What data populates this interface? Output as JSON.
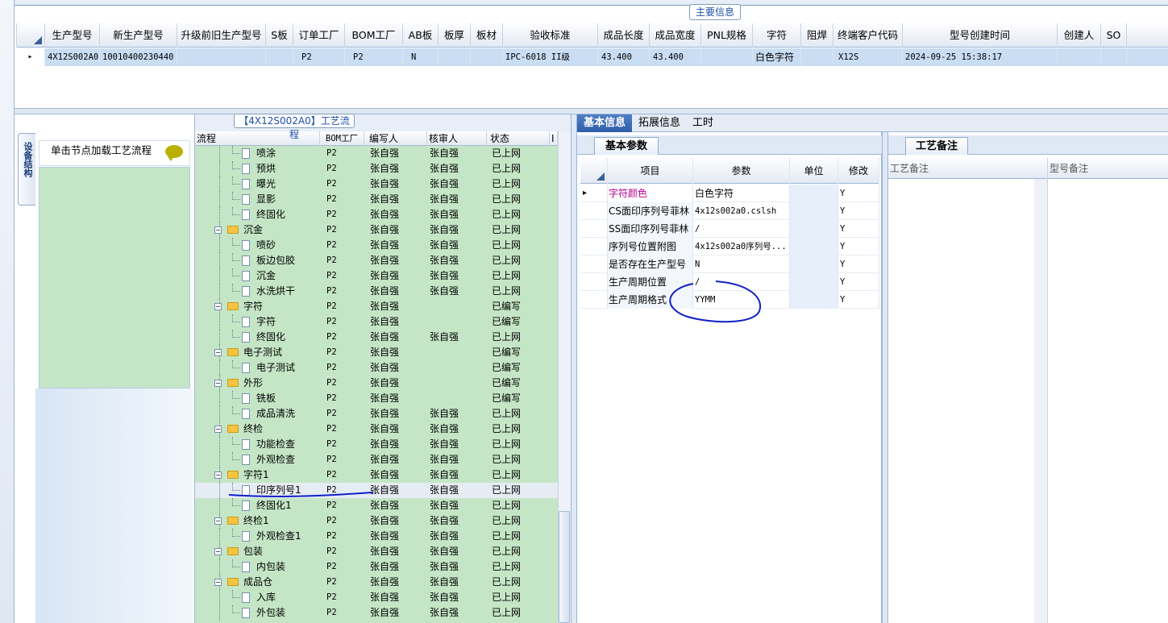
{
  "main_info": {
    "title": "主要信息",
    "columns": [
      "生产型号",
      "新生产型号",
      "升级前旧生产型号",
      "S板",
      "订单工厂",
      "BOM工厂",
      "AB板",
      "板厚",
      "板材",
      "验收标准",
      "成品长度",
      "成品宽度",
      "PNL规格",
      "字符",
      "阻焊",
      "终端客户代码",
      "型号创建时间",
      "创建人",
      "SO"
    ],
    "row": {
      "生产型号": "4X12S002A0",
      "新生产型号": "10010400230440",
      "订单工厂": "P2",
      "BOM工厂": "P2",
      "AB板": "N",
      "验收标准": "IPC-6018 II级",
      "成品长度": "43.400",
      "成品宽度": "43.400",
      "字符": "白色字符",
      "终端客户代码": "X12S",
      "型号创建时间": "2024-09-25 15:38:17"
    }
  },
  "left_panel": {
    "side_tab": "设备结构",
    "hint": "单击节点加载工艺流程"
  },
  "process": {
    "title": "【4X12S002A0】工艺流程",
    "headers": [
      "流程",
      "BOM工厂",
      "编写人",
      "核审人",
      "状态",
      "I"
    ],
    "rows": [
      {
        "level": 2,
        "type": "doc",
        "name": "喷涂",
        "bom": "P2",
        "writer": "张自强",
        "reviewer": "张自强",
        "status": "已上网"
      },
      {
        "level": 2,
        "type": "doc",
        "name": "预烘",
        "bom": "P2",
        "writer": "张自强",
        "reviewer": "张自强",
        "status": "已上网"
      },
      {
        "level": 2,
        "type": "doc",
        "name": "曝光",
        "bom": "P2",
        "writer": "张自强",
        "reviewer": "张自强",
        "status": "已上网"
      },
      {
        "level": 2,
        "type": "doc",
        "name": "显影",
        "bom": "P2",
        "writer": "张自强",
        "reviewer": "张自强",
        "status": "已上网"
      },
      {
        "level": 2,
        "type": "doc",
        "name": "终固化",
        "bom": "P2",
        "writer": "张自强",
        "reviewer": "张自强",
        "status": "已上网"
      },
      {
        "level": 1,
        "type": "folder",
        "name": "沉金",
        "bom": "P2",
        "writer": "张自强",
        "reviewer": "张自强",
        "status": "已上网"
      },
      {
        "level": 2,
        "type": "doc",
        "name": "喷砂",
        "bom": "P2",
        "writer": "张自强",
        "reviewer": "张自强",
        "status": "已上网"
      },
      {
        "level": 2,
        "type": "doc",
        "name": "板边包胶",
        "bom": "P2",
        "writer": "张自强",
        "reviewer": "张自强",
        "status": "已上网"
      },
      {
        "level": 2,
        "type": "doc",
        "name": "沉金",
        "bom": "P2",
        "writer": "张自强",
        "reviewer": "张自强",
        "status": "已上网"
      },
      {
        "level": 2,
        "type": "doc",
        "name": "水洗烘干",
        "bom": "P2",
        "writer": "张自强",
        "reviewer": "张自强",
        "status": "已上网"
      },
      {
        "level": 1,
        "type": "folder",
        "name": "字符",
        "bom": "P2",
        "writer": "张自强",
        "reviewer": "",
        "status": "已编写"
      },
      {
        "level": 2,
        "type": "doc",
        "name": "字符",
        "bom": "P2",
        "writer": "张自强",
        "reviewer": "",
        "status": "已编写"
      },
      {
        "level": 2,
        "type": "doc",
        "name": "终固化",
        "bom": "P2",
        "writer": "张自强",
        "reviewer": "张自强",
        "status": "已上网"
      },
      {
        "level": 1,
        "type": "folder",
        "name": "电子测试",
        "bom": "P2",
        "writer": "张自强",
        "reviewer": "",
        "status": "已编写"
      },
      {
        "level": 2,
        "type": "doc",
        "name": "电子测试",
        "bom": "P2",
        "writer": "张自强",
        "reviewer": "",
        "status": "已编写"
      },
      {
        "level": 1,
        "type": "folder",
        "name": "外形",
        "bom": "P2",
        "writer": "张自强",
        "reviewer": "",
        "status": "已编写"
      },
      {
        "level": 2,
        "type": "doc",
        "name": "铣板",
        "bom": "P2",
        "writer": "张自强",
        "reviewer": "",
        "status": "已编写"
      },
      {
        "level": 2,
        "type": "doc",
        "name": "成品清洗",
        "bom": "P2",
        "writer": "张自强",
        "reviewer": "张自强",
        "status": "已上网"
      },
      {
        "level": 1,
        "type": "folder",
        "name": "终检",
        "bom": "P2",
        "writer": "张自强",
        "reviewer": "张自强",
        "status": "已上网"
      },
      {
        "level": 2,
        "type": "doc",
        "name": "功能检查",
        "bom": "P2",
        "writer": "张自强",
        "reviewer": "张自强",
        "status": "已上网"
      },
      {
        "level": 2,
        "type": "doc",
        "name": "外观检查",
        "bom": "P2",
        "writer": "张自强",
        "reviewer": "张自强",
        "status": "已上网"
      },
      {
        "level": 1,
        "type": "folder",
        "name": "字符1",
        "bom": "P2",
        "writer": "张自强",
        "reviewer": "张自强",
        "status": "已上网"
      },
      {
        "level": 2,
        "type": "doc",
        "name": "印序列号1",
        "bom": "P2",
        "writer": "张自强",
        "reviewer": "张自强",
        "status": "已上网",
        "selected": true
      },
      {
        "level": 2,
        "type": "doc",
        "name": "终固化1",
        "bom": "P2",
        "writer": "张自强",
        "reviewer": "张自强",
        "status": "已上网"
      },
      {
        "level": 1,
        "type": "folder",
        "name": "终检1",
        "bom": "P2",
        "writer": "张自强",
        "reviewer": "张自强",
        "status": "已上网"
      },
      {
        "level": 2,
        "type": "doc",
        "name": "外观检查1",
        "bom": "P2",
        "writer": "张自强",
        "reviewer": "张自强",
        "status": "已上网"
      },
      {
        "level": 1,
        "type": "folder",
        "name": "包装",
        "bom": "P2",
        "writer": "张自强",
        "reviewer": "张自强",
        "status": "已上网"
      },
      {
        "level": 2,
        "type": "doc",
        "name": "内包装",
        "bom": "P2",
        "writer": "张自强",
        "reviewer": "张自强",
        "status": "已上网"
      },
      {
        "level": 1,
        "type": "folder",
        "name": "成品仓",
        "bom": "P2",
        "writer": "张自强",
        "reviewer": "张自强",
        "status": "已上网"
      },
      {
        "level": 2,
        "type": "doc",
        "name": "入库",
        "bom": "P2",
        "writer": "张自强",
        "reviewer": "张自强",
        "status": "已上网"
      },
      {
        "level": 2,
        "type": "doc",
        "name": "外包装",
        "bom": "P2",
        "writer": "张自强",
        "reviewer": "张自强",
        "status": "已上网"
      }
    ]
  },
  "right_tabs": [
    "基本信息",
    "拓展信息",
    "工时"
  ],
  "basic": {
    "tab": "基本参数",
    "headers": [
      "项目",
      "参数",
      "单位",
      "修改"
    ],
    "rows": [
      {
        "item": "字符颜色",
        "param": "白色字符",
        "unit": "",
        "modify": "Y",
        "highlight": true
      },
      {
        "item": "CS面印序列号菲林",
        "param": "4x12s002a0.cslsh",
        "unit": "",
        "modify": "Y"
      },
      {
        "item": "SS面印序列号菲林",
        "param": "/",
        "unit": "",
        "modify": "Y"
      },
      {
        "item": "序列号位置附图",
        "param": "4x12s002a0序列号...",
        "unit": "",
        "modify": "Y"
      },
      {
        "item": "是否存在生产型号",
        "param": "N",
        "unit": "",
        "modify": "Y"
      },
      {
        "item": "生产周期位置",
        "param": "/",
        "unit": "",
        "modify": "Y"
      },
      {
        "item": "生产周期格式",
        "param": "YYMM",
        "unit": "",
        "modify": "Y"
      }
    ]
  },
  "notes": {
    "tab": "工艺备注",
    "headers": [
      "工艺备注",
      "型号备注"
    ]
  },
  "colors": {
    "accent": "#2e5ea8",
    "green": "#c5e6c6",
    "selected": "#c9ddf3",
    "highlight_text": "#b5008c",
    "annotation": "#1020c8"
  }
}
